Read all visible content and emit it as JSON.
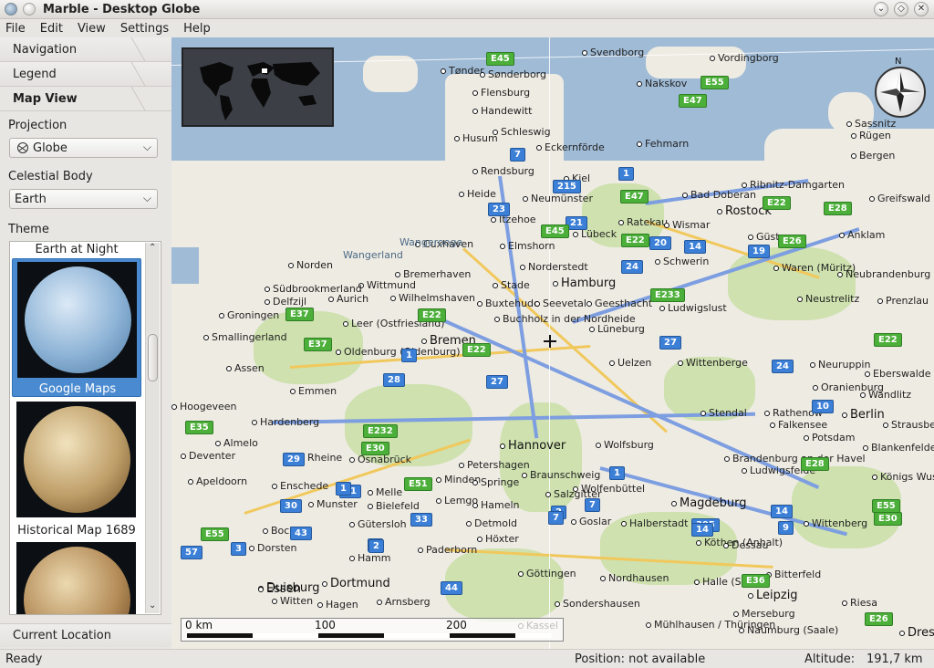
{
  "window": {
    "title": "Marble - Desktop Globe"
  },
  "menu": [
    "File",
    "Edit",
    "View",
    "Settings",
    "Help"
  ],
  "sidebar": {
    "tabs": {
      "navigation": "Navigation",
      "legend": "Legend",
      "map_view": "Map View",
      "current_location": "Current Location"
    },
    "projection_label": "Projection",
    "projection_value": "Globe",
    "celestial_label": "Celestial Body",
    "celestial_value": "Earth",
    "theme_label": "Theme",
    "themes": {
      "first": "Earth at Night",
      "second": "Google Maps",
      "third": "Historical Map 1689"
    }
  },
  "map": {
    "cities": [
      "Tønder",
      "Sønderborg",
      "Svendborg",
      "Vordingborg",
      "Nakskov",
      "Flensburg",
      "Handewitt",
      "Schleswig",
      "Eckernförde",
      "Husum",
      "Fehmarn",
      "Sassnitz",
      "Rügen",
      "Bergen",
      "Rendsburg",
      "Kiel",
      "Heide",
      "Neumünster",
      "Bad Doberan",
      "Rostock",
      "Ribnitz-Damgarten",
      "Greifswald",
      "Itzehoe",
      "Ratekau",
      "Wismar",
      "Lübeck",
      "Cuxhaven",
      "Elmshorn",
      "Güstrow",
      "Schwerin",
      "Anklam",
      "Norden",
      "Norderstedt",
      "Bremerhaven",
      "Wittmund",
      "Stade",
      "Hamburg",
      "Waren (Müritz)",
      "Neubrandenburg",
      "Südbrookmerland",
      "Aurich",
      "Wilhelmshaven",
      "Buxtehude",
      "Seevetal",
      "Geesthacht",
      "Delfzijl",
      "Leer (Ostfriesland)",
      "Buchholz in der Nordheide",
      "Lüneburg",
      "Ludwigslust",
      "Neustrelitz",
      "Prenzlau",
      "Groningen",
      "Oldenburg (Oldenburg)",
      "Bremen",
      "Smallingerland",
      "Assen",
      "Uelzen",
      "Wittenberge",
      "Neuruppin",
      "Eberswalde",
      "Emmen",
      "Oranienburg",
      "Wandlitz",
      "Berlin",
      "Hoogeveen",
      "Stendal",
      "Rathenow",
      "Falkensee",
      "Strausberg",
      "Hardenberg",
      "Potsdam",
      "Blankenfelde",
      "Almelo",
      "Hannover",
      "Wolfsburg",
      "Deventer",
      "Rheine",
      "Osnabrück",
      "Petershagen",
      "Brandenburg an der Havel",
      "Ludwigsfelde",
      "Königs Wusterhausen",
      "Apeldoorn",
      "Enschede",
      "Minden",
      "Springe",
      "Braunschweig",
      "Wolfenbüttel",
      "Salzgitter",
      "Magdeburg",
      "Melle",
      "Lemgo",
      "Hameln",
      "Munster",
      "Bielefeld",
      "Gütersloh",
      "Detmold",
      "Goslar",
      "Halberstadt",
      "Wittenberg",
      "Bocholt",
      "Dorsten",
      "Hamm",
      "Paderborn",
      "Höxter",
      "Köthen (Anhalt)",
      "Dessau",
      "Bitterfeld",
      "Göttingen",
      "Nordhausen",
      "Halle (Saale)",
      "Leipzig",
      "Duisburg",
      "Essen",
      "Dortmund",
      "Witten",
      "Hagen",
      "Arnsberg",
      "Sondershausen",
      "Merseburg",
      "Riesa",
      "Mühlhausen / Thüringen",
      "Naumburg (Saale)",
      "Dresden",
      "Kassel"
    ],
    "sea_labels": [
      "Wangerland",
      "Wangerooge"
    ],
    "autobahns": [
      "7",
      "215",
      "1",
      "21",
      "23",
      "24",
      "20",
      "14",
      "19",
      "27",
      "1",
      "28",
      "29",
      "31",
      "30",
      "1",
      "2",
      "2",
      "7",
      "395",
      "14",
      "9",
      "33",
      "43",
      "3",
      "2",
      "44",
      "57",
      "14",
      "1",
      "7",
      "27",
      "10",
      "24"
    ],
    "euroroutes": [
      "E45",
      "E47",
      "E55",
      "E47",
      "E22",
      "E45",
      "E22",
      "E26",
      "E28",
      "E233",
      "E22",
      "E22",
      "E22",
      "E37",
      "E37",
      "E232",
      "E30",
      "E35",
      "E51",
      "E55",
      "E36",
      "E55",
      "E30",
      "E26",
      "E28"
    ],
    "scale": {
      "label_0": "0 km",
      "label_100": "100",
      "label_200": "200"
    },
    "compass_label": "N"
  },
  "status": {
    "ready": "Ready",
    "position": "Position: not available",
    "altitude_label": "Altitude:",
    "altitude_value": "191,7 km"
  }
}
